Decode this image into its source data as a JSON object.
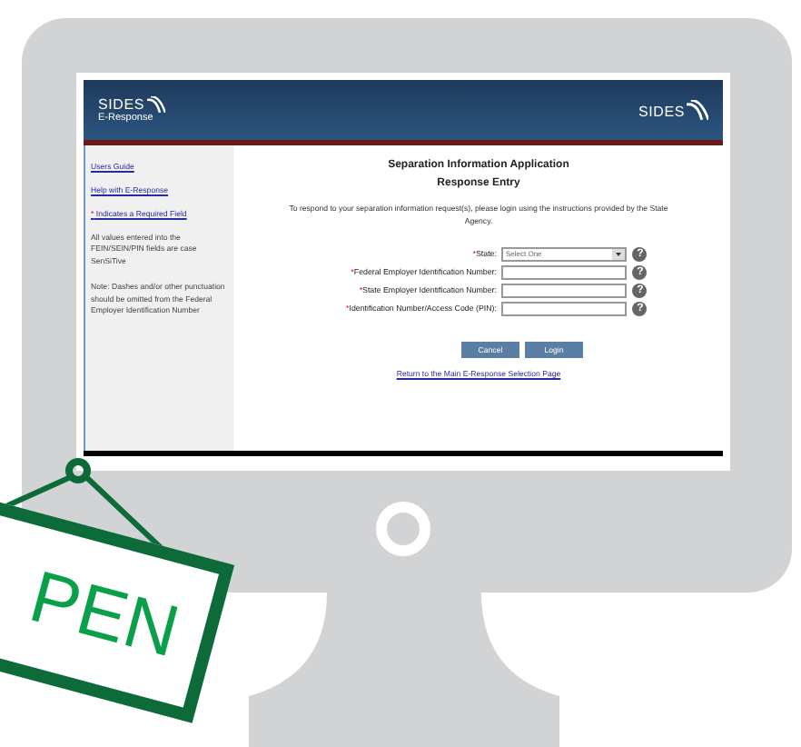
{
  "header": {
    "logo_left": {
      "title": "SIDES",
      "subtitle": "E-Response"
    },
    "logo_right": {
      "title": "SIDES"
    }
  },
  "sidebar": {
    "links": [
      "Users Guide",
      "Help with E-Response"
    ],
    "required_note": {
      "mark": "*",
      "text": "Indicates a Required Field"
    },
    "notes": [
      "All values entered into the FEIN/SEIN/PIN fields are case SenSiTive",
      "Note: Dashes and/or other punctuation should be omitted from the Federal Employer Identification Number"
    ]
  },
  "content": {
    "title": "Separation Information Application",
    "subtitle": "Response Entry",
    "intro": "To respond to your separation information request(s), please login using the instructions provided by the State Agency.",
    "fields": [
      {
        "kind": "select",
        "mark": "*",
        "label": "State:",
        "value": "Select One",
        "help": "?"
      },
      {
        "kind": "text",
        "mark": "*",
        "label": "Federal Employer Identification Number:",
        "help": "?"
      },
      {
        "kind": "text",
        "mark": "*",
        "label": "State Employer Identification Number:",
        "help": "?"
      },
      {
        "kind": "text",
        "mark": "*",
        "label": "Identification Number/Access Code (PIN):",
        "help": "?"
      }
    ],
    "buttons": [
      "Cancel",
      "Login"
    ],
    "return_link": "Return to the Main E-Response Selection Page"
  },
  "sign": {
    "text": "PEN"
  }
}
